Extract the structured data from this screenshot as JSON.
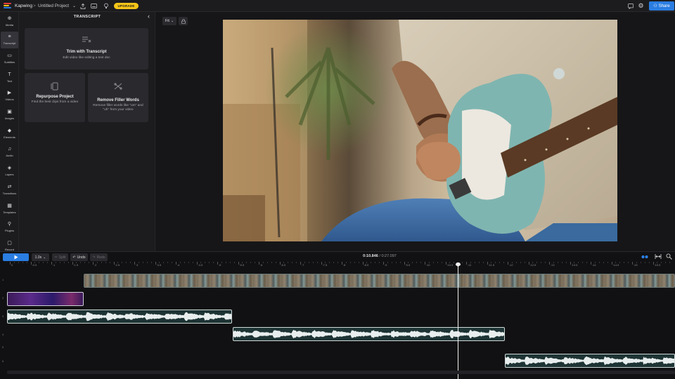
{
  "topbar": {
    "brand": "Kapwing",
    "breadcrumb_sep": ">",
    "project_name": "Untitled Project",
    "upgrade_label": "UPGRADE",
    "share_label": "Share",
    "brand_colors": [
      "#e63f3f",
      "#f5c518",
      "#2a7de1"
    ]
  },
  "nav": {
    "items": [
      {
        "label": "Media",
        "icon": "media-icon",
        "glyph": "⊕"
      },
      {
        "label": "Transcript",
        "icon": "transcript-icon",
        "glyph": "≡"
      },
      {
        "label": "Subtitles",
        "icon": "subtitles-icon",
        "glyph": "▭"
      },
      {
        "label": "Text",
        "icon": "text-icon",
        "glyph": "T"
      },
      {
        "label": "Videos",
        "icon": "videos-icon",
        "glyph": "▶"
      },
      {
        "label": "Images",
        "icon": "images-icon",
        "glyph": "▣"
      },
      {
        "label": "Elements",
        "icon": "elements-icon",
        "glyph": "◆"
      },
      {
        "label": "Audio",
        "icon": "audio-icon",
        "glyph": "♫"
      },
      {
        "label": "Layers",
        "icon": "layers-icon",
        "glyph": "◈"
      },
      {
        "label": "Transitions",
        "icon": "transitions-icon",
        "glyph": "⇄"
      },
      {
        "label": "Templates",
        "icon": "templates-icon",
        "glyph": "▦"
      },
      {
        "label": "Plugins",
        "icon": "plugins-icon",
        "glyph": "⚲"
      },
      {
        "label": "Record",
        "icon": "record-icon",
        "glyph": "▢"
      }
    ],
    "active_index": 1
  },
  "panel": {
    "title": "TRANSCRIPT",
    "cards": [
      {
        "title": "Trim with Transcript",
        "desc": "Edit video like editing a text doc",
        "icon": "transcript-trim-icon"
      },
      {
        "title": "Repurpose Project",
        "desc": "Find the best clips from a video",
        "icon": "repurpose-icon"
      },
      {
        "title": "Remove Filler Words",
        "desc": "Remove filler words like \"um\" and \"uh\" from your video",
        "icon": "filler-words-icon"
      }
    ]
  },
  "canvas": {
    "fit_label": "Fit"
  },
  "timeline": {
    "speed": "1.0x",
    "split_label": "Split",
    "undo_label": "Undo",
    "redo_label": "Redo",
    "current_time": "0:10.846",
    "total_time": "/ 0:27.097",
    "ruler_labels": [
      "0",
      ":0.5",
      ":1",
      ":1.5",
      ":2",
      ":2.5",
      ":3",
      ":3.5",
      ":4",
      ":4.5",
      ":5",
      ":5.5",
      ":6",
      ":6.5",
      ":7",
      ":7.5",
      ":8",
      ":8.5",
      ":9",
      ":9.5",
      ":10",
      ":10.5",
      ":11",
      ":11.5",
      ":12",
      ":12.5",
      ":13",
      ":13.5",
      ":14",
      ":14.5",
      ":15",
      ":15.5"
    ],
    "row_numbers": [
      "1",
      "2",
      "3",
      "4",
      "5",
      "6"
    ],
    "playhead_seconds": 10.846,
    "accent_color": "#2a7de1"
  }
}
